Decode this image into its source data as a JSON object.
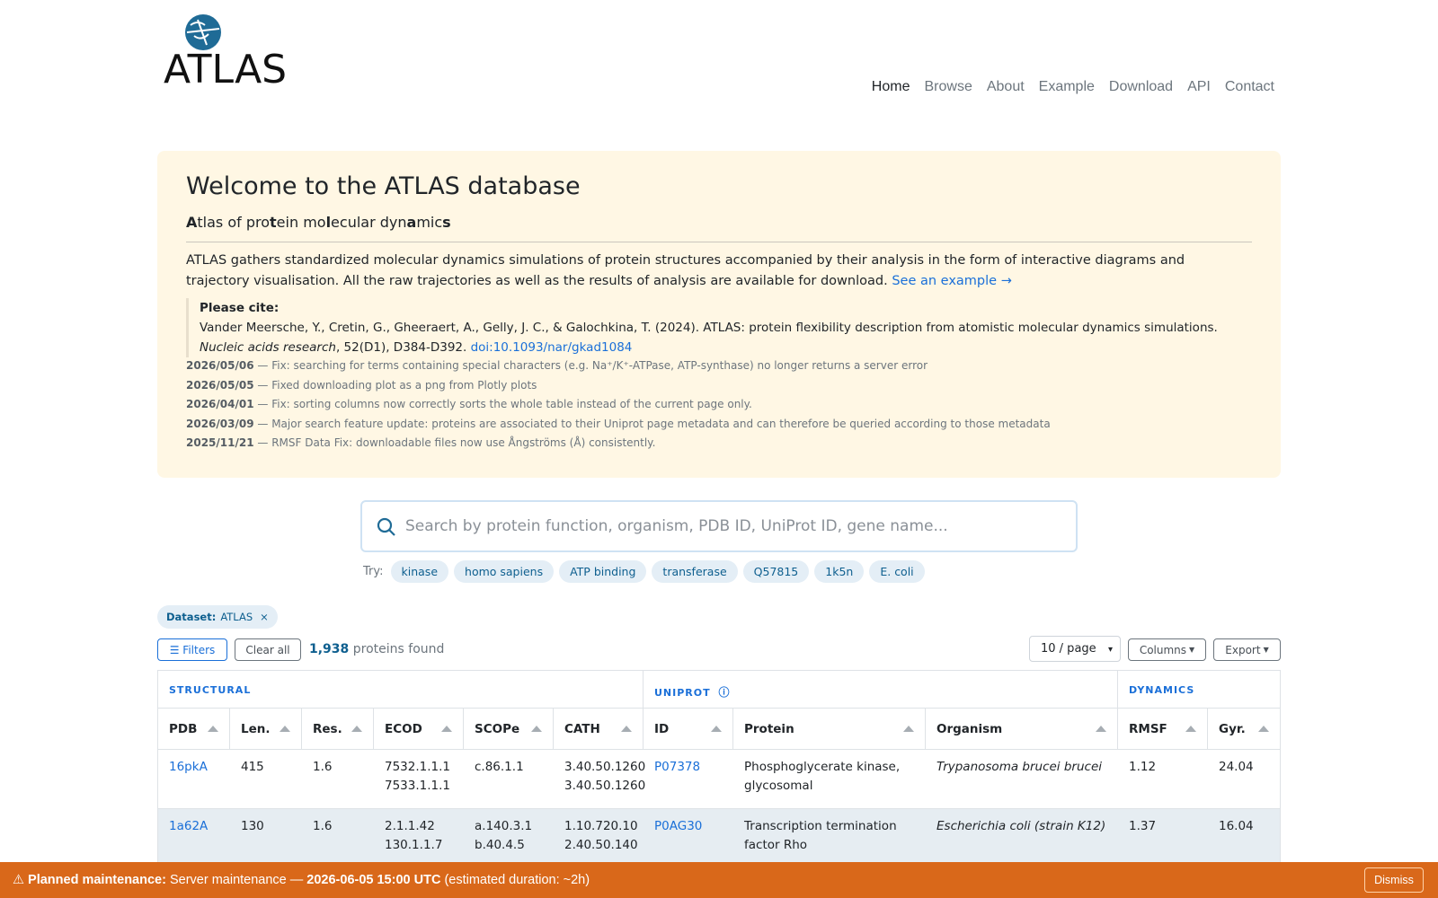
{
  "logo": {
    "text": "ATLAS"
  },
  "nav": [
    {
      "label": "Home",
      "active": true
    },
    {
      "label": "Browse"
    },
    {
      "label": "About"
    },
    {
      "label": "Example"
    },
    {
      "label": "Download"
    },
    {
      "label": "API"
    },
    {
      "label": "Contact"
    }
  ],
  "welcome": {
    "title": "Welcome to the ATLAS database",
    "description": "ATLAS gathers standardized molecular dynamics simulations of protein structures accompanied by their analysis in the form of interactive diagrams and trajectory visualisation. All the raw trajectories as well as the results of analysis are available for download.",
    "example_link": "See an example →",
    "cite_label": "Please cite:",
    "cite_text": "Vander Meersche, Y., Cretin, G., Gheeraert, A., Gelly, J. C., & Galochkina, T. (2024). ATLAS: protein flexibility description from atomistic molecular dynamics simulations.",
    "cite_journal": "Nucleic acids research",
    "cite_rest": ", 52(D1), D384-D392.",
    "cite_doi": "doi:10.1093/nar/gkad1084",
    "news": [
      {
        "date": "2026/05/06",
        "text": "— Fix: searching for terms containing special characters (e.g. Na⁺/K⁺-ATPase, ATP-synthase) no longer returns a server error"
      },
      {
        "date": "2026/05/05",
        "text": "— Fixed downloading plot as a png from Plotly plots"
      },
      {
        "date": "2026/04/01",
        "text": "— Fix: sorting columns now correctly sorts the whole table instead of the current page only."
      },
      {
        "date": "2026/03/09",
        "text": "— Major search feature update: proteins are associated to their Uniprot page metadata and can therefore be queried according to those metadata"
      },
      {
        "date": "2025/11/21",
        "text": "— RMSF Data Fix: downloadable files now use Ångströms (Å) consistently."
      }
    ]
  },
  "search": {
    "placeholder": "Search by protein function, organism, PDB ID, UniProt ID, gene name...",
    "try_label": "Try:",
    "suggestions": [
      "kinase",
      "homo sapiens",
      "ATP binding",
      "transferase",
      "Q57815",
      "1k5n",
      "E. coli"
    ]
  },
  "dataset_filter": {
    "label": "Dataset:",
    "value": "ATLAS",
    "remove": "×"
  },
  "toolbar": {
    "filters": "☰ Filters",
    "clear_all": "Clear all",
    "count": "1,938",
    "count_suffix": "proteins found",
    "page_size": "10 / page",
    "columns": "Columns",
    "export": "Export"
  },
  "table": {
    "groups": [
      "STRUCTURAL",
      "UNIPROT",
      "DYNAMICS"
    ],
    "info_icon": "ⓘ",
    "columns": [
      "PDB",
      "Len.",
      "Res.",
      "ECOD",
      "SCOPe",
      "CATH",
      "ID",
      "Protein",
      "Organism",
      "RMSF",
      "Gyr."
    ],
    "rows": [
      {
        "pdb": "16pkA",
        "len": "415",
        "res": "1.6",
        "ecod1": "7532.1.1.1",
        "ecod2": "7533.1.1.1",
        "scope1": "c.86.1.1",
        "scope2": "",
        "cath1": "3.40.50.1260",
        "cath2": "3.40.50.1260",
        "uniprot": "P07378",
        "protein1": "Phosphoglycerate kinase,",
        "protein2": "glycosomal",
        "organism": "Trypanosoma brucei brucei",
        "rmsf": "1.12",
        "gyr": "24.04"
      },
      {
        "pdb": "1a62A",
        "len": "130",
        "res": "1.6",
        "ecod1": "2.1.1.42",
        "ecod2": "130.1.1.7",
        "scope1": "a.140.3.1",
        "scope2": "b.40.4.5",
        "cath1": "1.10.720.10",
        "cath2": "2.40.50.140",
        "uniprot": "P0AG30",
        "protein1": "Transcription termination",
        "protein2": "factor Rho",
        "organism": "Escherichia coli (strain K12)",
        "rmsf": "1.37",
        "gyr": "16.04"
      }
    ]
  },
  "banner": {
    "icon": "⚠",
    "label": "Planned maintenance:",
    "text": "Server maintenance —",
    "datetime": "2026-06-05 15:00 UTC",
    "duration": "(estimated duration: ~2h)",
    "dismiss": "Dismiss"
  }
}
